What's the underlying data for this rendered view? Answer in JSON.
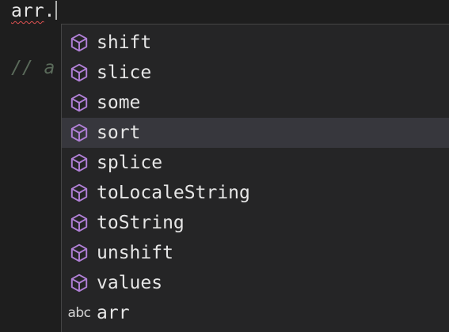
{
  "editor": {
    "code_identifier": "arr",
    "code_dot": ".",
    "comment_partial": "// a"
  },
  "suggestions": {
    "selected_index": 3,
    "items": [
      {
        "label": "shift",
        "kind": "method-cube-icon"
      },
      {
        "label": "slice",
        "kind": "method-cube-icon"
      },
      {
        "label": "some",
        "kind": "method-cube-icon"
      },
      {
        "label": "sort",
        "kind": "method-cube-icon"
      },
      {
        "label": "splice",
        "kind": "method-cube-icon"
      },
      {
        "label": "toLocaleString",
        "kind": "method-cube-icon"
      },
      {
        "label": "toString",
        "kind": "method-cube-icon"
      },
      {
        "label": "unshift",
        "kind": "method-cube-icon"
      },
      {
        "label": "values",
        "kind": "method-cube-icon"
      },
      {
        "label": "arr",
        "kind": "text-abc-icon",
        "kind_text": "abc"
      }
    ]
  },
  "colors": {
    "background": "#1e1e1e",
    "widget_bg": "#252526",
    "selected_row": "#37373d",
    "method_icon": "#b180d7",
    "squiggle": "#e05252"
  }
}
